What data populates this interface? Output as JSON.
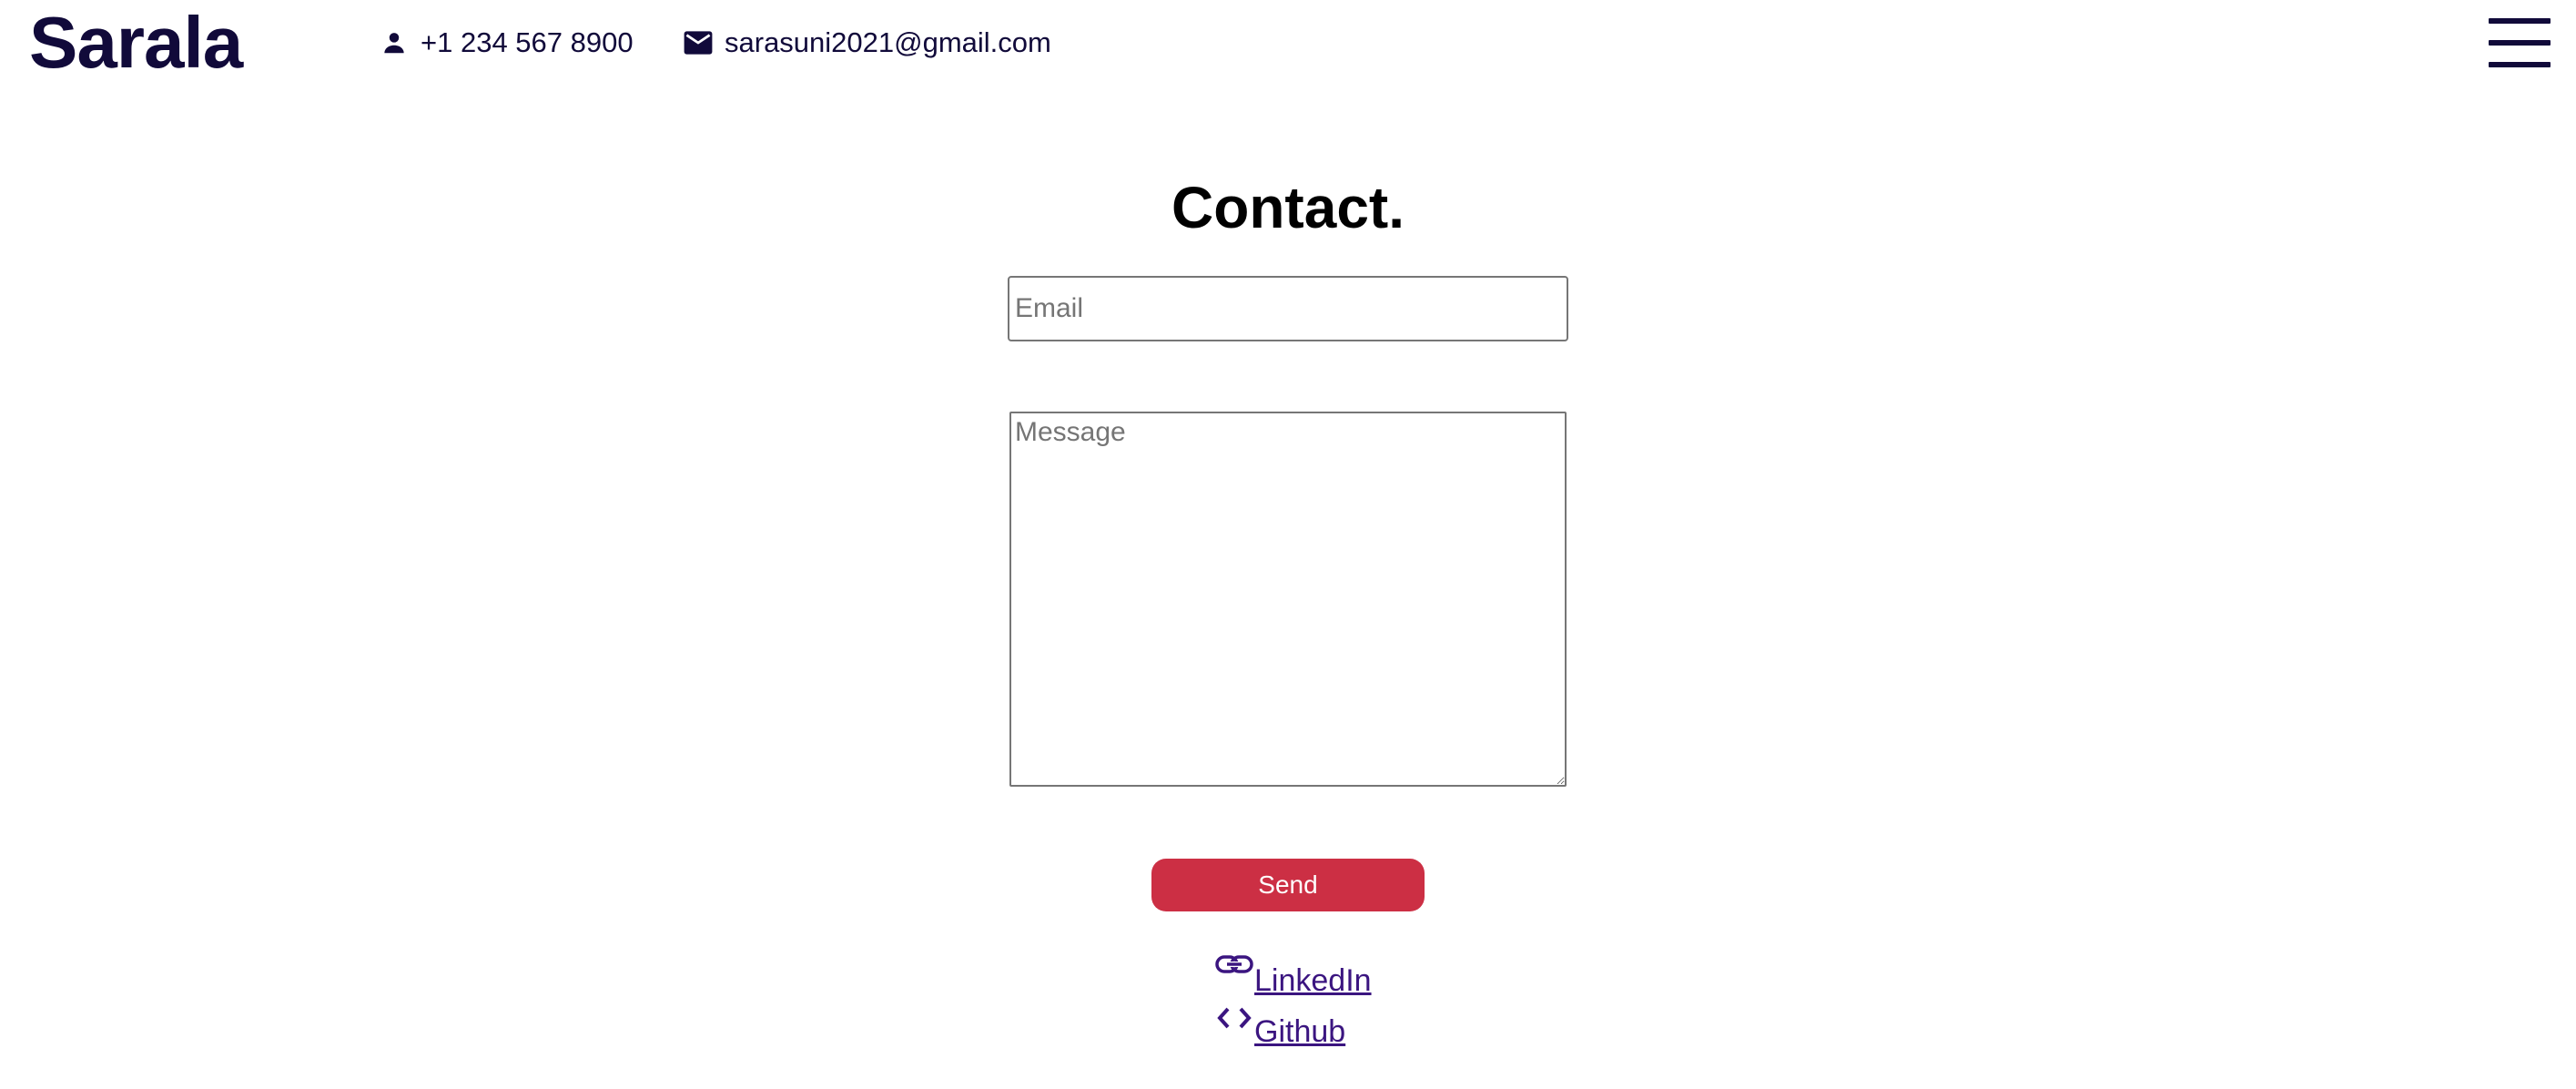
{
  "header": {
    "brand": "Sarala",
    "phone": "+1 234 567 8900",
    "email": "sarasuni2021@gmail.com",
    "phone_icon": "person-icon",
    "email_icon": "envelope-icon",
    "menu_icon": "hamburger-menu-icon"
  },
  "contact": {
    "title": "Contact.",
    "email_placeholder": "Email",
    "email_value": "",
    "message_placeholder": "Message",
    "message_value": "",
    "send_label": "Send"
  },
  "links": [
    {
      "label": "LinkedIn",
      "icon": "link-icon"
    },
    {
      "label": "Github",
      "icon": "code-icon"
    }
  ],
  "colors": {
    "brand": "#110a3a",
    "send_button": "#cc2f44",
    "link": "#3b1580"
  }
}
